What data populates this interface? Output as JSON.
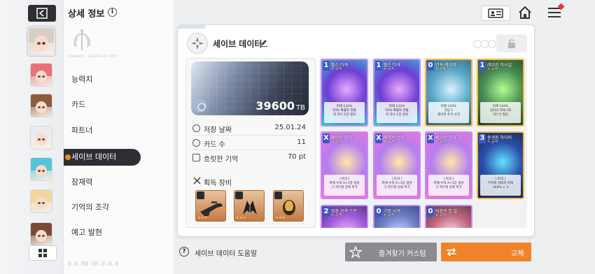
{
  "header": {
    "title": "상세 정보",
    "info_icon": "i"
  },
  "left_nav": {
    "back_icon": "back-arrow-icon",
    "grid_icon": "grid-icon",
    "characters": [
      {
        "name": "character-1",
        "hair": "#d8cfc4",
        "active": true
      },
      {
        "name": "character-2",
        "hair": "#e4727c"
      },
      {
        "name": "character-3",
        "hair": "#8c5a3c"
      },
      {
        "name": "character-4",
        "hair": "#ececec"
      },
      {
        "name": "character-5",
        "hair": "#58c3d8"
      },
      {
        "name": "character-6",
        "hair": "#f0d7a0"
      },
      {
        "name": "character-7",
        "hair": "#7a4a36"
      }
    ]
  },
  "menu": {
    "emblem_text": "ACADEMY · SCHOOL OF ARTS",
    "items": [
      "능력치",
      "카드",
      "파트너",
      "세이브 데이터",
      "잠재력",
      "기억의 조각",
      "예고 발현"
    ],
    "active_index": 3,
    "version": "0.0.00-SH.0.0.0"
  },
  "top_right": {
    "profile_card_icon": "id-card-icon",
    "home_icon": "home-icon",
    "menu_icon": "hamburger-menu-icon"
  },
  "save": {
    "name": "세이브 데이터",
    "tb_value": "39600",
    "tb_unit": "TB",
    "stats": [
      {
        "label": "저장 날짜",
        "value": "25.01.24",
        "icon": "clock-icon"
      },
      {
        "label": "카드 수",
        "value": "11",
        "icon": "coin-icon"
      },
      {
        "label": "흐릿한 기억",
        "value": "70 pt",
        "icon": "memory-icon"
      }
    ],
    "equipment_title": "획득 장비",
    "equipment": [
      {
        "name": "weapon-rifle",
        "stars": "★ ★ ★"
      },
      {
        "name": "armor-black",
        "stars": "★ ★ ★"
      },
      {
        "name": "gauntlet-gold",
        "stars": "★ ★ ★"
      }
    ]
  },
  "cards": [
    {
      "cost": "1",
      "title": "펄스 타격",
      "type": "공격",
      "desc": "피해 132%\n50% 확률로 관통\n적 하나 1장 생성",
      "art": [
        "#e8a9ff",
        "#6f3dd3",
        "#21d8c8"
      ],
      "border": "purple"
    },
    {
      "cost": "1",
      "title": "펄스 타격",
      "type": "공격",
      "desc": "피해 132%\n50% 확률로 관통\n적 하나 1장 생성",
      "art": [
        "#e8a9ff",
        "#6f3dd3",
        "#21d8c8"
      ],
      "border": "purple"
    },
    {
      "cost": "0",
      "title": "연속 레이저",
      "type": "강화",
      "desc": "피해 120%\n전방 1\n레이저 추가 사격",
      "art": [
        "#d6f4ff",
        "#5aa6c7",
        "#2d5e7b"
      ],
      "border": "gold"
    },
    {
      "cost": "1",
      "title": "레이저 미사일",
      "type": "공격",
      "desc": "피해 144%\n임의의 적에 2회\n1번 더 발동",
      "art": [
        "#b0ff94",
        "#4b8e54",
        "#1f3b2e"
      ],
      "border": "gold"
    },
    {
      "cost": "X",
      "title": "세이브 코어",
      "type": "공격",
      "desc": "[ 파괴 ]\n피해 누적 X+1장 생성\n그 카드에 강화 추가",
      "art": [
        "#ffe8a8",
        "#b57ef0",
        "#ff70c9"
      ],
      "border": "purple"
    },
    {
      "cost": "X",
      "title": "세이브 코어",
      "type": "공격",
      "desc": "[ 파괴 ]\n피해 누적 X+1장 생성\n그 카드에 강화 추가",
      "art": [
        "#ffe8a8",
        "#b57ef0",
        "#ff70c9"
      ],
      "border": "purple"
    },
    {
      "cost": "X",
      "title": "세이브 코어",
      "type": "공격",
      "desc": "[ 파괴 ]\n피해 누적 X+1장 생성\n그 카드에 강화 추가",
      "art": [
        "#ffe8a8",
        "#b57ef0",
        "#ff70c9"
      ],
      "border": "purple"
    },
    {
      "cost": "3",
      "title": "충격파 하이퍼",
      "type": "공격",
      "desc": "[ 파괴 ]\n무작위 적에게 피해\n144% × 3",
      "art": [
        "#63e3ff",
        "#2b4fa8",
        "#15213f"
      ],
      "border": "gold"
    },
    {
      "cost": "2",
      "title": "집중 공격 스턴",
      "type": "공격",
      "desc": "",
      "art": [
        "#ffc9ef",
        "#a45de0",
        "#3c2a66"
      ],
      "border": "purple"
    },
    {
      "cost": "0",
      "title": "기동 사격",
      "type": "공격",
      "desc": "",
      "art": [
        "#d4e4ff",
        "#6f7fc9",
        "#2e3a6b"
      ],
      "border": "purple"
    },
    {
      "cost": "0",
      "title": "비장의 한 발",
      "type": "공격",
      "desc": "",
      "art": [
        "#fff0f0",
        "#c36a82",
        "#4a2a39"
      ],
      "border": "purple"
    }
  ],
  "footer": {
    "help_text": "세이브 데이터 도움말",
    "help_icon": "?",
    "favorite_label": "즐겨찾기 커스텀",
    "swap_label": "교체"
  },
  "colors": {
    "accent": "#f0832a",
    "dark": "#2d2f35",
    "favorite_btn": "#8b8b8f"
  }
}
